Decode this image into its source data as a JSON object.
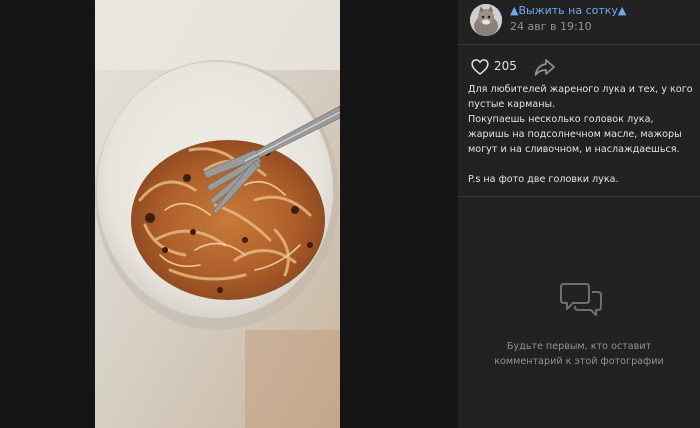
{
  "post": {
    "author": "▲Выжить на сотку▲",
    "date": "24 авг в 19:10",
    "likes": "205",
    "caption": [
      "Для любителей жареного лука и тех, у кого пустые карманы.",
      "Покупаешь несколько головок лука, жаришь на подсолнечном масле, мажоры могут и на сливочном, и наслаждаешься.",
      "P.s на фото две головки лука."
    ]
  },
  "comments": {
    "empty_line1": "Будьте первым, кто оставит",
    "empty_line2": "комментарий к этой фотографии"
  },
  "icons": {
    "like": "heart-outline",
    "share": "share-arrow",
    "comment": "speech-bubbles"
  },
  "colors": {
    "author_link": "#71aaeb",
    "muted_text": "#939393",
    "panel_bg": "#222222",
    "viewer_bg": "#141414"
  }
}
